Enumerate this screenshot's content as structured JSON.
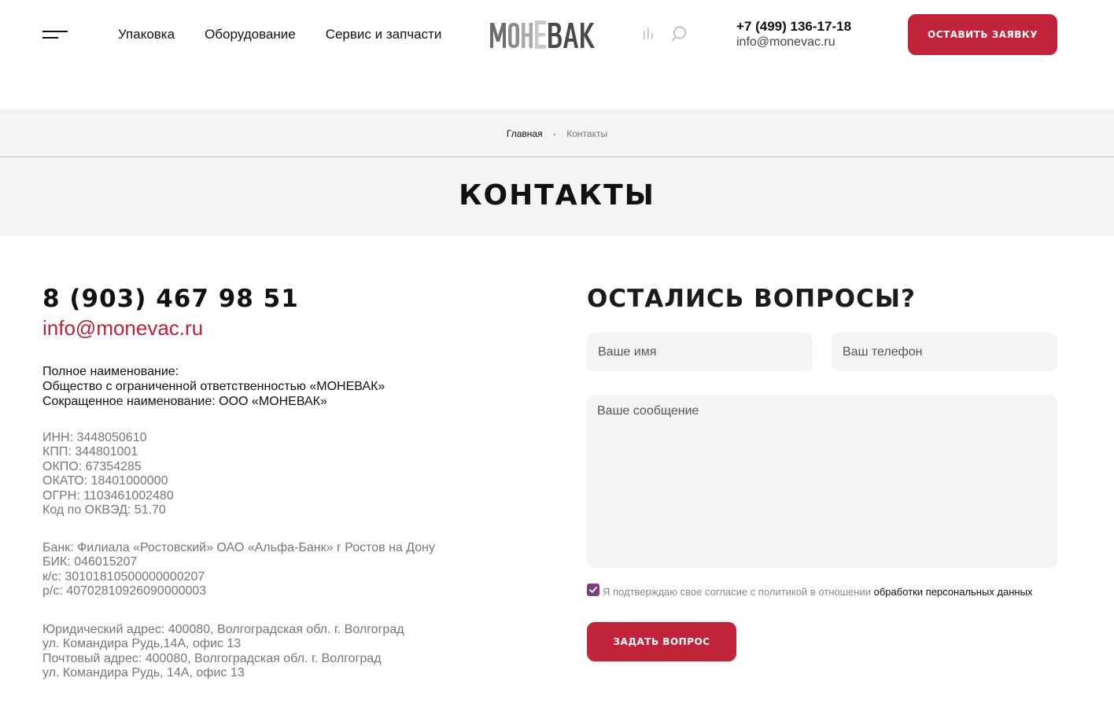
{
  "header": {
    "nav": [
      "Упаковка",
      "Оборудование",
      "Сервис и запчасти"
    ],
    "logo_text": "МОНЕВАК",
    "phone": "+7 (499) 136-17-18",
    "email": "info@monevac.ru",
    "request_button": "Оставить заявку"
  },
  "breadcrumbs": {
    "home": "Главная",
    "separator": "·",
    "current": "Контакты"
  },
  "page_title": "КОНТАКТЫ",
  "contacts": {
    "phone": "8 (903) 467 98 51",
    "email": "info@monevac.ru",
    "names": [
      "Полное наименование:",
      "Общество с ограниченной ответственностью «МОНЕВАК»",
      "Сокращенное наименование: ООО «МОНЕВАК»"
    ],
    "requisites": [
      "ИНН: 3448050610",
      "КПП: 344801001",
      "ОКПО: 67354285",
      "ОКАТО: 18401000000",
      "ОГРН: 1103461002480",
      "Код по ОКВЭД: 51.70"
    ],
    "bank": [
      "Банк: Филиала «Ростовский» ОАО «Альфа-Банк» г Ростов на Дону",
      "БИК: 046015207",
      "к/с: 30101810500000000207",
      "р/с: 40702810926090000003"
    ],
    "address": [
      "Юридический адрес: 400080, Волгоградская обл. г. Волгоград",
      "ул. Командира Рудь,14А, офис 13",
      "Почтовый адрес: 400080, Волгоградская обл. г. Волгоград",
      "ул. Командира Рудь, 14А, офис 13"
    ]
  },
  "form": {
    "title": "ОСТАЛИСЬ ВОПРОСЫ?",
    "name_placeholder": "Ваше имя",
    "phone_placeholder": "Ваш телефон",
    "message_placeholder": "Ваше сообщение",
    "consent_text": "Я подтверждаю свое согласие с политикой в отношении ",
    "consent_link": "обработки персональных данных",
    "consent_checked": true,
    "submit_button": "Задать вопрос"
  },
  "colors": {
    "accent": "#c0233a",
    "checkbox": "#7d3f7a",
    "band": "#f4f4f4"
  },
  "icons": [
    "menu-icon",
    "stats-icon",
    "search-icon",
    "checkmark-icon"
  ]
}
